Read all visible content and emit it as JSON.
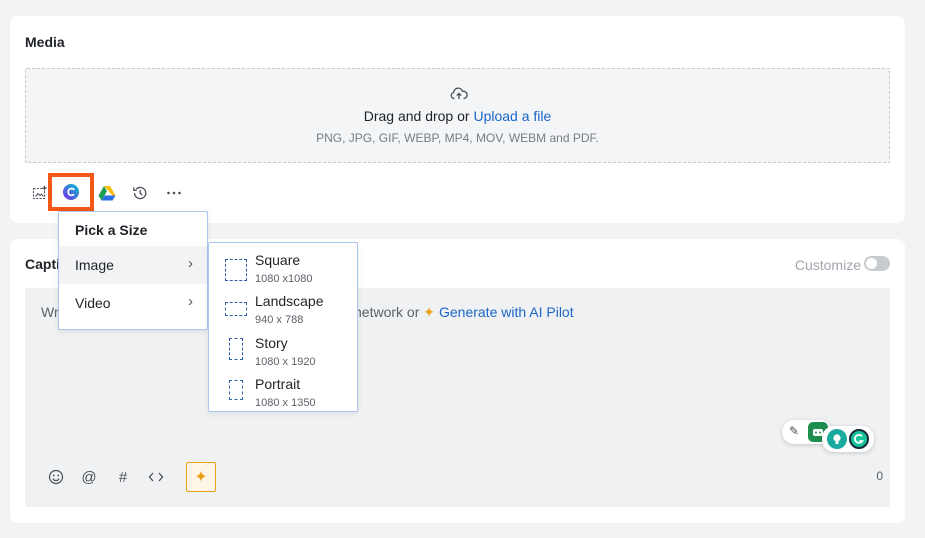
{
  "media": {
    "title": "Media",
    "dropzone": {
      "prefix": "Drag and drop or ",
      "upload_link": "Upload a file",
      "formats": "PNG, JPG, GIF, WEBP, MP4, MOV, WEBM and PDF."
    },
    "toolbar": [
      {
        "icon": "image-add-icon"
      },
      {
        "icon": "canva-icon",
        "highlighted": true,
        "highlight_color": "#f25716"
      },
      {
        "icon": "google-drive-icon"
      },
      {
        "icon": "history-icon"
      },
      {
        "icon": "more-icon"
      }
    ]
  },
  "size_menu": {
    "heading": "Pick a Size",
    "items": [
      {
        "label": "Image",
        "selected": true
      },
      {
        "label": "Video"
      }
    ]
  },
  "size_submenu": {
    "options": [
      {
        "name": "Square",
        "dims": "1080 x1080"
      },
      {
        "name": "Landscape",
        "dims": "940 x 788"
      },
      {
        "name": "Story",
        "dims": "1080 x 1920"
      },
      {
        "name": "Portrait",
        "dims": "1080 x 1350"
      }
    ]
  },
  "caption": {
    "title": "Capti",
    "customize_label": "Customize",
    "customize_enabled": false,
    "placeholder_left": "Wr",
    "placeholder_right": "l network or ",
    "ai_link": "Generate with AI Pilot",
    "char_count": "0",
    "editor_icons": [
      "emoji-icon",
      "mention-icon",
      "hashtag-icon",
      "code-icon",
      "ai-sparkle-icon"
    ]
  },
  "colors": {
    "accent": "#1a66c9",
    "highlight": "#f25716",
    "ai": "#e8a11a",
    "menu_border": "#a9c6ee"
  }
}
